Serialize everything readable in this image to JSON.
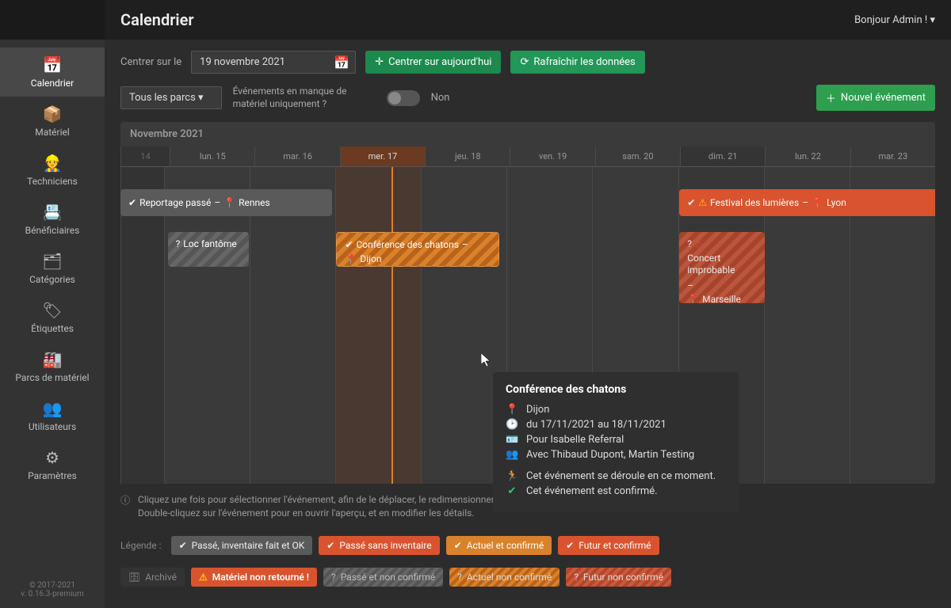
{
  "header": {
    "title": "Calendrier",
    "user_greeting": "Bonjour Admin !"
  },
  "sidebar": {
    "items": [
      {
        "label": "Calendrier",
        "icon": "calendar"
      },
      {
        "label": "Matériel",
        "icon": "box"
      },
      {
        "label": "Techniciens",
        "icon": "people-carry"
      },
      {
        "label": "Bénéficiaires",
        "icon": "address-book"
      },
      {
        "label": "Catégories",
        "icon": "sitemap"
      },
      {
        "label": "Étiquettes",
        "icon": "tags"
      },
      {
        "label": "Parcs de matériel",
        "icon": "industry"
      },
      {
        "label": "Utilisateurs",
        "icon": "users-cog"
      },
      {
        "label": "Paramètres",
        "icon": "sliders"
      }
    ]
  },
  "footer": {
    "copyright": "© 2017-2021",
    "version": "v. 0.16.3-premium"
  },
  "toolbar": {
    "center_label": "Centrer sur le",
    "date_value": "19 novembre 2021",
    "center_today": "Centrer sur aujourd'hui",
    "refresh": "Rafraîchir les données"
  },
  "filters": {
    "park_select": "Tous les parcs",
    "missing_label": "Événements en manque de matériel uniquement ?",
    "toggle_value": "Non",
    "new_event": "Nouvel événement"
  },
  "calendar": {
    "month": "Novembre 2021",
    "days": [
      {
        "label": "14"
      },
      {
        "label": "lun. 15"
      },
      {
        "label": "mar. 16"
      },
      {
        "label": "mer. 17"
      },
      {
        "label": "jeu. 18"
      },
      {
        "label": "ven. 19"
      },
      {
        "label": "sam. 20"
      },
      {
        "label": "dim. 21"
      },
      {
        "label": "lun. 22"
      },
      {
        "label": "mar. 23"
      }
    ]
  },
  "events": {
    "reportage": {
      "title": "Reportage passé",
      "location": "Rennes"
    },
    "loc": {
      "title": "Loc fantôme"
    },
    "conference": {
      "title": "Conférence des chatons",
      "location": "Dijon"
    },
    "festival": {
      "title": "Festival des lumières",
      "location": "Lyon"
    },
    "concert": {
      "title": "Concert improbable",
      "location": "Marseille"
    }
  },
  "tooltip": {
    "title": "Conférence des chatons",
    "location": "Dijon",
    "dates": "du 17/11/2021 au 18/11/2021",
    "for": "Pour Isabelle Referral",
    "with": "Avec Thibaud Dupont, Martin Testing",
    "status1": "Cet événement se déroule en ce moment.",
    "status2": "Cet événement est confirmé."
  },
  "help": {
    "line1": "Cliquez une fois pour sélectionner l'événement, afin de le déplacer, le redimensionner ou le supprimer.",
    "line2": "Double-cliquez sur l'événement pour en ouvrir l'aperçu, et en modifier les détails."
  },
  "legend": {
    "label": "Légende :",
    "past_ok": "Passé, inventaire fait et OK",
    "past_noinv": "Passé sans inventaire",
    "current_conf": "Actuel et confirmé",
    "future_conf": "Futur et confirmé",
    "archived": "Archivé",
    "not_returned": "Matériel non retourné !",
    "past_unconf": "Passé et non confirmé",
    "current_unconf": "Actuel non confirmé",
    "future_unconf": "Futur non confirmé"
  }
}
